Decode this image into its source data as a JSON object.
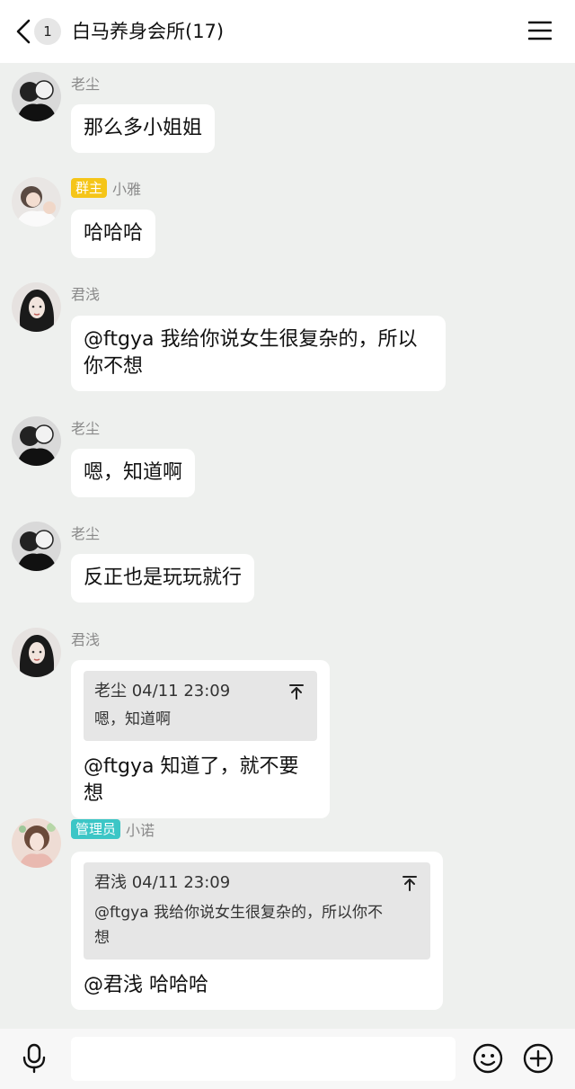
{
  "header": {
    "unread_count": "1",
    "title": "白马养身会所(17)"
  },
  "messages": [
    {
      "name": "老尘",
      "badge": "",
      "text": "那么多小姐姐"
    },
    {
      "name": "小雅",
      "badge": "群主",
      "text": "哈哈哈"
    },
    {
      "name": "君浅",
      "badge": "",
      "text_line1": "@ftgya 我给你说女生很复杂的，所以",
      "text_line2": "你不想"
    },
    {
      "name": "老尘",
      "badge": "",
      "text": "嗯，知道啊"
    },
    {
      "name": "老尘",
      "badge": "",
      "text": "反正也是玩玩就行"
    },
    {
      "name": "君浅",
      "badge": "",
      "quote_head": "老尘 04/11 23:09",
      "quote_text": "嗯，知道啊",
      "text": "@ftgya 知道了，就不要想"
    },
    {
      "name": "小诺",
      "badge": "管理员",
      "quote_head": "君浅 04/11 23:09",
      "quote_line1": "@ftgya 我给你说女生很复杂的，所以你不",
      "quote_line2": "想",
      "text": "@君浅 哈哈哈"
    }
  ],
  "input": {
    "value": "",
    "placeholder": ""
  },
  "colors": {
    "owner_badge": "#f5c518",
    "admin_badge": "#3cc6c6",
    "background": "#eef0ee"
  },
  "icons": [
    "back-icon",
    "menu-icon",
    "microphone-icon",
    "emoji-icon",
    "plus-icon",
    "jump-to-icon"
  ]
}
